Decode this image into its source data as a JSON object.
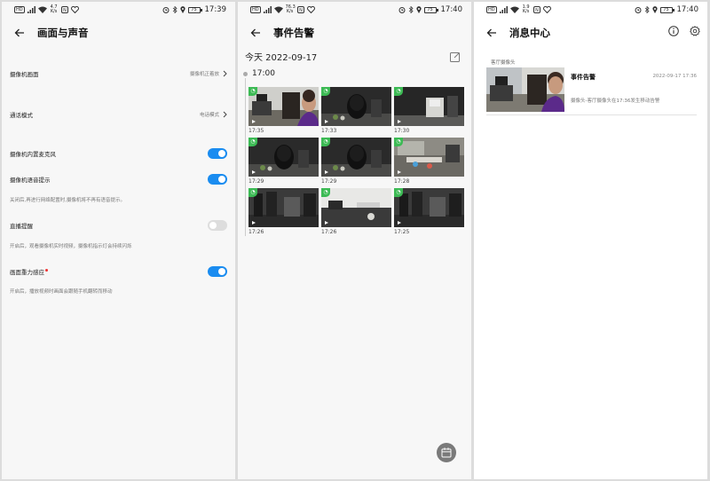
{
  "panel1": {
    "status": {
      "speed_top": "4.7",
      "speed_unit": "K/s",
      "battery": "75",
      "time": "17:39"
    },
    "title": "画面与声音",
    "camera_picture": {
      "label": "摄像机画面",
      "value": "摄像机正着放"
    },
    "call_mode": {
      "label": "通话模式",
      "value": "电话模式"
    },
    "mic": {
      "label": "摄像机内置麦克风",
      "on": true
    },
    "voice_prompt": {
      "label": "摄像机语音提示",
      "on": true,
      "desc": "关闭后,再进行网络配置时,摄像机将不再有语音提示。"
    },
    "live_reminder": {
      "label": "直播提醒",
      "on": false,
      "desc": "开启后，观看摄像机实时视频，摄像机指示灯会持续闪烁"
    },
    "gravity": {
      "label": "画面重力感应",
      "on": true,
      "desc": "开启后，播放视频时画面会跟随手机翻转而移动"
    }
  },
  "panel2": {
    "status": {
      "speed_top": "76.3",
      "speed_unit": "K/s",
      "battery": "75",
      "time": "17:40"
    },
    "title": "事件告警",
    "date": "今天  2022-09-17",
    "hour": "17:00",
    "events": [
      {
        "time": "17:35",
        "scene": "person"
      },
      {
        "time": "17:33",
        "scene": "speaker"
      },
      {
        "time": "17:30",
        "scene": "dark"
      },
      {
        "time": "17:29",
        "scene": "speaker"
      },
      {
        "time": "17:29",
        "scene": "speaker"
      },
      {
        "time": "17:28",
        "scene": "desk"
      },
      {
        "time": "17:26",
        "scene": "desk-dark"
      },
      {
        "time": "17:26",
        "scene": "table"
      },
      {
        "time": "17:25",
        "scene": "desk-dark"
      }
    ]
  },
  "panel3": {
    "status": {
      "speed_top": "1.9",
      "speed_unit": "K/s",
      "battery": "75",
      "time": "17:40"
    },
    "title": "消息中心",
    "section": "客厅摄像头",
    "message": {
      "title": "事件告警",
      "time": "2022-09-17 17:36",
      "desc": "摄像头-客厅摄像头在17:36发生移动告警"
    }
  },
  "colors": {
    "accent": "#1a8cf0",
    "event_tag": "#3cba54",
    "shirt": "#5b2a8a"
  },
  "icons": [
    "back-arrow-icon",
    "chevron-right-icon",
    "edit-icon",
    "calendar-icon",
    "info-icon",
    "gear-icon",
    "play-icon"
  ]
}
